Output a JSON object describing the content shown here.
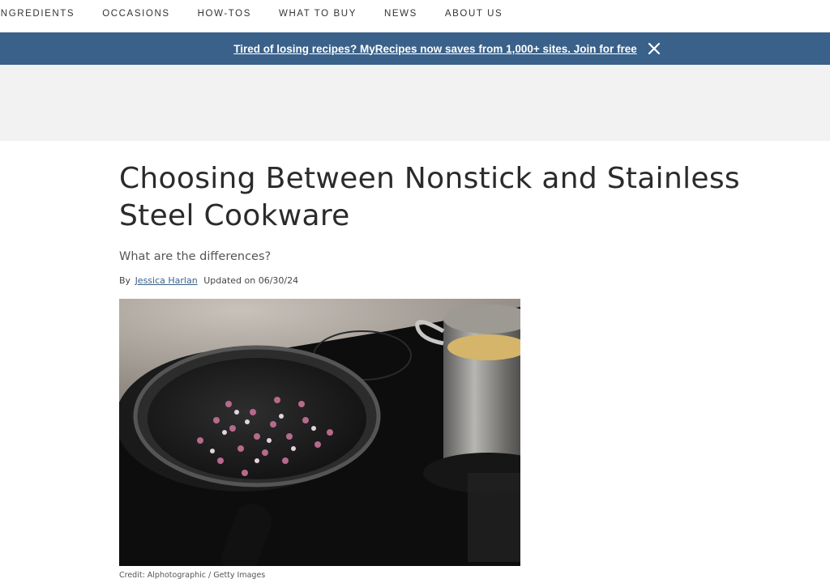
{
  "nav": {
    "items": [
      {
        "label": "INGREDIENTS"
      },
      {
        "label": "OCCASIONS"
      },
      {
        "label": "HOW-TOS"
      },
      {
        "label": "WHAT TO BUY"
      },
      {
        "label": "NEWS"
      },
      {
        "label": "ABOUT US"
      }
    ]
  },
  "promo": {
    "text": "Tired of losing recipes? MyRecipes now saves from 1,000+ sites. Join for free",
    "close_icon": "close-icon",
    "background": "#3a6189"
  },
  "article": {
    "title_line1": "Choosing Between Nonstick and Stainless",
    "title_line2": "Steel Cookware",
    "subtitle": "What are the differences?",
    "byline_prefix": "By",
    "author": "Jessica Harlan",
    "updated": "Updated on 06/30/24",
    "image_credit": "Credit: Alphotographic / Getty Images"
  }
}
